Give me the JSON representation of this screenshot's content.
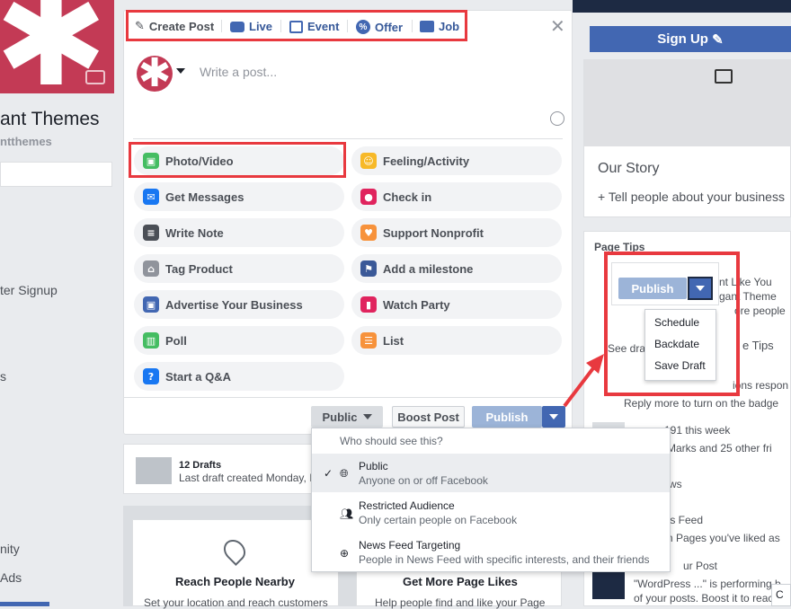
{
  "background": {
    "page_name": "ant Themes",
    "page_handle": "ntthemes",
    "left_items": [
      "ter Signup",
      "s",
      "nity",
      "Ads"
    ],
    "signup_label": "Sign Up",
    "our_story": "Our Story",
    "tell_people": "+ Tell people about your business",
    "page_tips": "Page Tips",
    "right_snippets": [
      "nt Like You",
      "gant Theme",
      "ore people",
      "See dra",
      "e Tips",
      "ions respon",
      "Reply more to turn on the badge",
      "+191 this week",
      "a Marks and 25 other fri",
      "llows",
      "ges Feed",
      "om Pages you've liked as",
      "ur Post",
      "\"WordPress ...\" is performing b",
      "of your posts. Boost it to reach",
      "C"
    ],
    "drafts_title": "12 Drafts",
    "drafts_sub": "Last draft created Monday, I",
    "reach_title": "Reach People Nearby",
    "reach_sub": "Set your location and reach customers",
    "likes_title": "Get More Page Likes",
    "likes_sub": "Help people find and like your Page"
  },
  "composer": {
    "tabs": [
      {
        "label": "Create Post",
        "icon": "pencil-icon"
      },
      {
        "label": "Live",
        "icon": "video-icon"
      },
      {
        "label": "Event",
        "icon": "calendar-icon"
      },
      {
        "label": "Offer",
        "icon": "percent-icon"
      },
      {
        "label": "Job",
        "icon": "briefcase-icon"
      }
    ],
    "placeholder": "Write a post...",
    "actions": [
      {
        "label": "Photo/Video",
        "icon": "photo-icon",
        "color": "#45bd62"
      },
      {
        "label": "Feeling/Activity",
        "icon": "smiley-icon",
        "color": "#f7b928"
      },
      {
        "label": "Get Messages",
        "icon": "messenger-icon",
        "color": "#1877f2"
      },
      {
        "label": "Check in",
        "icon": "location-pin-icon",
        "color": "#e0245e"
      },
      {
        "label": "Write Note",
        "icon": "note-icon",
        "color": "#4b4f56"
      },
      {
        "label": "Support Nonprofit",
        "icon": "heart-coin-icon",
        "color": "#f7923b"
      },
      {
        "label": "Tag Product",
        "icon": "tag-icon",
        "color": "#90949c"
      },
      {
        "label": "Add a milestone",
        "icon": "flag-icon",
        "color": "#3b5998"
      },
      {
        "label": "Advertise Your Business",
        "icon": "advertise-icon",
        "color": "#4267b2"
      },
      {
        "label": "Watch Party",
        "icon": "popcorn-icon",
        "color": "#e0245e"
      },
      {
        "label": "Poll",
        "icon": "poll-icon",
        "color": "#45bd62"
      },
      {
        "label": "List",
        "icon": "list-icon",
        "color": "#f7923b"
      },
      {
        "label": "Start a Q&A",
        "icon": "question-icon",
        "color": "#1877f2"
      }
    ],
    "public_label": "Public",
    "boost_label": "Boost Post",
    "publish_label": "Publish"
  },
  "audience": {
    "header": "Who should see this?",
    "options": [
      {
        "title": "Public",
        "sub": "Anyone on or off Facebook",
        "icon": "globe-icon",
        "selected": true
      },
      {
        "title": "Restricted Audience",
        "sub": "Only certain people on Facebook",
        "icon": "people-icon",
        "selected": false
      },
      {
        "title": "News Feed Targeting",
        "sub": "People in News Feed with specific interests, and their friends",
        "icon": "target-icon",
        "selected": false
      }
    ]
  },
  "publish_menu": {
    "publish_label": "Publish",
    "items": [
      "Schedule",
      "Backdate",
      "Save Draft"
    ]
  },
  "colors": {
    "highlight": "#e8393f",
    "brand": "#4267b2",
    "accent": "#365899"
  }
}
